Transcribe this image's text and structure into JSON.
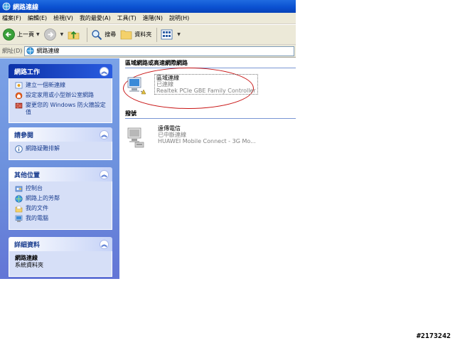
{
  "window": {
    "title": "網路連線"
  },
  "menu": [
    {
      "label": "檔案(F)"
    },
    {
      "label": "編輯(E)"
    },
    {
      "label": "檢視(V)"
    },
    {
      "label": "我的最愛(A)"
    },
    {
      "label": "工具(T)"
    },
    {
      "label": "進階(N)"
    },
    {
      "label": "說明(H)"
    }
  ],
  "toolbar": {
    "back_label": "上一頁",
    "search_label": "搜尋",
    "folders_label": "資料夾"
  },
  "address": {
    "label": "網址(D)",
    "value": "網路連線"
  },
  "sidebar": {
    "tasks": {
      "title": "網路工作",
      "items": [
        {
          "label": "建立一個新連線"
        },
        {
          "label": "設定家用或小型辦公室網路"
        },
        {
          "label": "變更您的 Windows 防火牆設定值"
        }
      ]
    },
    "see_also": {
      "title": "請參閱",
      "items": [
        {
          "label": "網路疑難排解"
        }
      ]
    },
    "other_places": {
      "title": "其他位置",
      "items": [
        {
          "label": "控制台"
        },
        {
          "label": "網路上的芳鄰"
        },
        {
          "label": "我的文件"
        },
        {
          "label": "我的電腦"
        }
      ]
    },
    "details": {
      "title": "詳細資料",
      "name": "網路連線",
      "type": "系統資料夾"
    }
  },
  "content": {
    "lan_group": {
      "header": "區域網路或高速網際網路",
      "connection": {
        "name": "區域連線",
        "status": "已連線",
        "device": "Realtek PCIe GBE Family Controller"
      }
    },
    "dialup_group": {
      "header": "撥號",
      "connection": {
        "name": "遠傳電信",
        "status": "已中斷連線",
        "device": "HUAWEI Mobile Connect - 3G Mo..."
      }
    }
  },
  "watermark": "#2173242"
}
